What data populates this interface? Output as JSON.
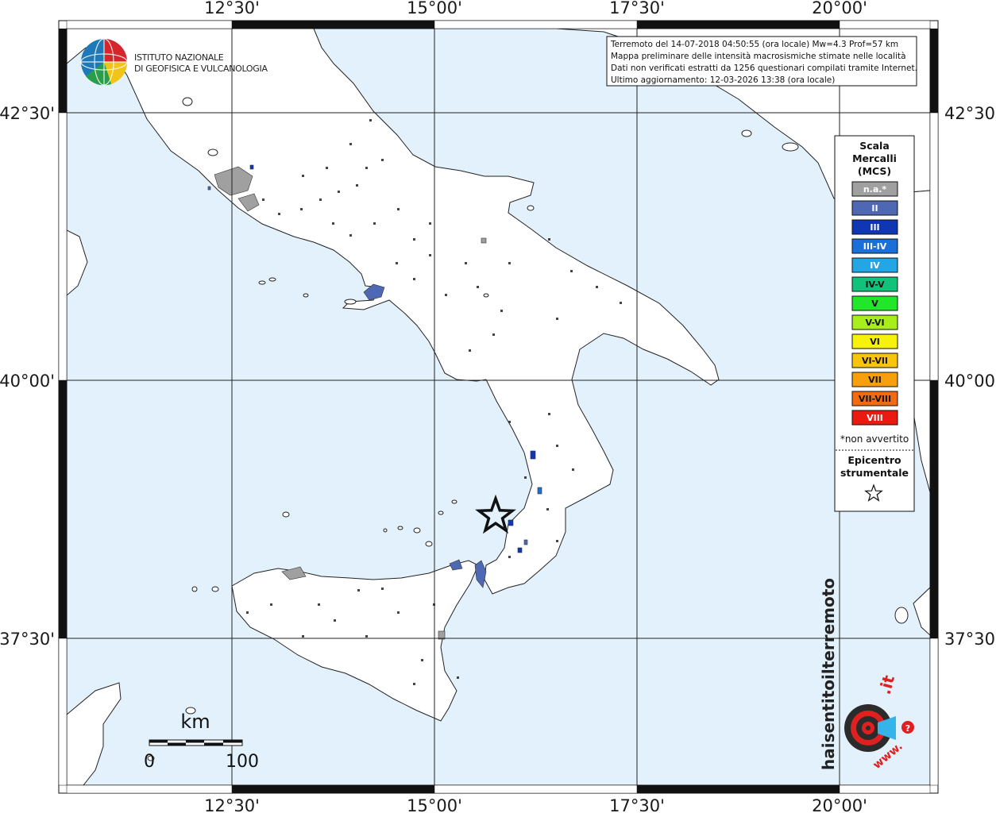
{
  "info": {
    "lines": [
      "Terremoto del 14-07-2018 04:50:55 (ora locale) Mw=4.3 Prof=57 km",
      "Mappa preliminare delle intensità macrosismiche stimate nelle località",
      "Dati non verificati estratti da 1256 questionari compilati tramite Internet.",
      "Ultimo aggiornamento: 12-03-2026 13:38 (ora locale)"
    ]
  },
  "ingv": {
    "line1": "ISTITUTO NAZIONALE",
    "line2": "DI GEOFISICA E VULCANOLOGIA"
  },
  "longitude_labels": [
    "12°30'",
    "15°00'",
    "17°30'",
    "20°00'"
  ],
  "latitude_labels": [
    "42°30'",
    "40°00'",
    "37°30'"
  ],
  "legend": {
    "title_lines": [
      "Scala",
      "Mercalli",
      "(MCS)"
    ],
    "classes": [
      {
        "label": "n.a.*",
        "color": "#a0a0a0",
        "text_color": "#ffffff"
      },
      {
        "label": "II",
        "color": "#4f68b3",
        "text_color": "#ffffff"
      },
      {
        "label": "III",
        "color": "#0f37b3",
        "text_color": "#ffffff"
      },
      {
        "label": "III-IV",
        "color": "#1a6fd8",
        "text_color": "#ffffff"
      },
      {
        "label": "IV",
        "color": "#22a6e6",
        "text_color": "#ffffff"
      },
      {
        "label": "IV-V",
        "color": "#11c27a",
        "text_color": "#111111"
      },
      {
        "label": "V",
        "color": "#22e62a",
        "text_color": "#111111"
      },
      {
        "label": "V-VI",
        "color": "#a8ee1c",
        "text_color": "#111111"
      },
      {
        "label": "VI",
        "color": "#f6f20c",
        "text_color": "#111111"
      },
      {
        "label": "VI-VII",
        "color": "#f8c40c",
        "text_color": "#111111"
      },
      {
        "label": "VII",
        "color": "#f8a00c",
        "text_color": "#111111"
      },
      {
        "label": "VII-VIII",
        "color": "#f36a10",
        "text_color": "#111111"
      },
      {
        "label": "VIII",
        "color": "#ea1a10",
        "text_color": "#ffffff"
      }
    ],
    "note": "*non avvertito",
    "epicenter_lines": [
      "Epicentro",
      "strumentale"
    ]
  },
  "scale_bar": {
    "unit": "km",
    "min": "0",
    "max": "100"
  },
  "watermark": {
    "text_main": "haisentitoilterremoto",
    "text_it": ".it",
    "text_www": "www.",
    "question": "?"
  },
  "colors": {
    "sea": "#e2f1fb",
    "land": "#ffffff",
    "coast": "#222222",
    "grid": "#222222"
  }
}
